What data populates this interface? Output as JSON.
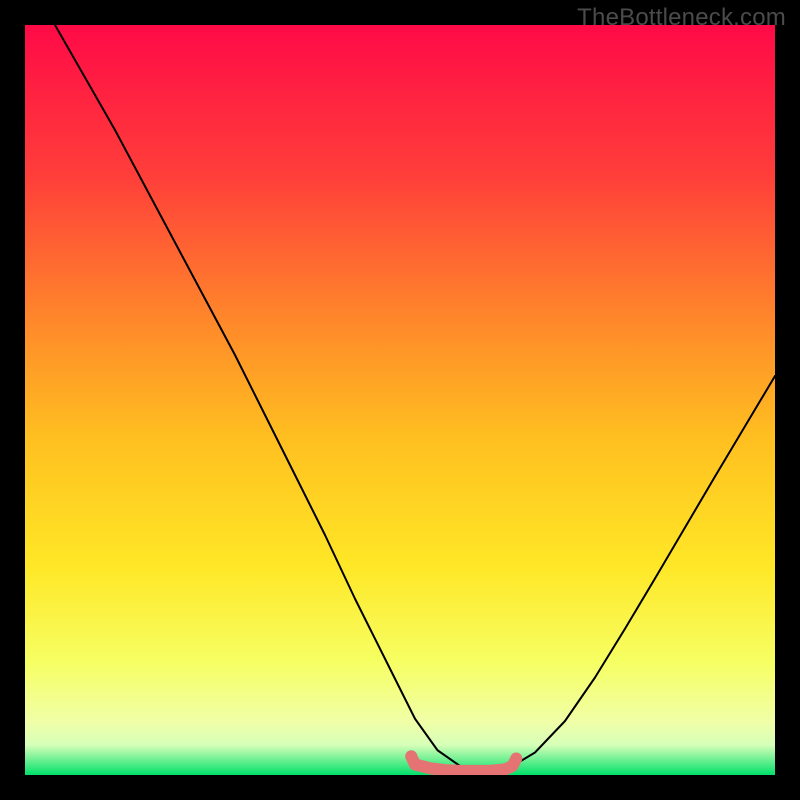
{
  "watermark": "TheBottleneck.com",
  "chart_data": {
    "type": "line",
    "title": "",
    "xlabel": "",
    "ylabel": "",
    "xlim": [
      0,
      100
    ],
    "ylim": [
      0,
      100
    ],
    "gradient_stops": [
      {
        "offset": 0,
        "color": "#ff0a47"
      },
      {
        "offset": 20,
        "color": "#ff3e3a"
      },
      {
        "offset": 40,
        "color": "#ff8a2a"
      },
      {
        "offset": 55,
        "color": "#ffbf20"
      },
      {
        "offset": 72,
        "color": "#ffe726"
      },
      {
        "offset": 85,
        "color": "#f6ff63"
      },
      {
        "offset": 93,
        "color": "#f0ffa8"
      },
      {
        "offset": 96,
        "color": "#d6ffb8"
      },
      {
        "offset": 100,
        "color": "#00e06a"
      }
    ],
    "series": [
      {
        "name": "bottleneck-curve",
        "stroke": "#000000",
        "stroke_width": 2,
        "x": [
          4,
          8,
          12,
          16,
          20,
          24,
          28,
          32,
          36,
          40,
          44,
          48.5,
          52,
          55,
          58,
          60,
          62,
          65,
          68,
          72,
          76,
          80,
          84,
          88,
          92,
          96,
          100
        ],
        "values": [
          100,
          93,
          86,
          78.5,
          71,
          63.5,
          56,
          48,
          40,
          32,
          23.5,
          14.5,
          7.5,
          3.3,
          1.2,
          0.55,
          0.55,
          1.2,
          3,
          7.2,
          13,
          19.5,
          26.2,
          33,
          39.8,
          46.5,
          53.2
        ]
      },
      {
        "name": "flat-zone-marker",
        "stroke": "#e57373",
        "stroke_width": 12,
        "x": [
          51.5,
          52,
          54,
          56,
          58,
          60,
          62,
          64,
          65,
          65.5
        ],
        "values": [
          2.5,
          1.4,
          0.9,
          0.65,
          0.55,
          0.55,
          0.55,
          0.75,
          1.2,
          2.2
        ]
      }
    ]
  }
}
